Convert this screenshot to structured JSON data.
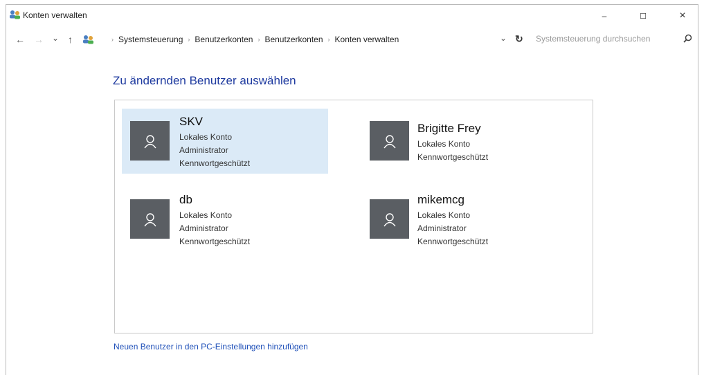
{
  "window": {
    "title": "Konten verwalten",
    "minimize_glyph": "–",
    "maximize_glyph": "☐",
    "close_glyph": "×"
  },
  "address_bar": {
    "back_glyph": "←",
    "forward_glyph": "→",
    "recent_glyph": "⌄",
    "up_glyph": "↑",
    "breadcrumbs": [
      "Systemsteuerung",
      "Benutzerkonten",
      "Benutzerkonten",
      "Konten verwalten"
    ],
    "separator": "›",
    "dropdown_glyph": "⌄",
    "refresh_glyph": "↻",
    "search_placeholder": "Systemsteuerung durchsuchen"
  },
  "main": {
    "heading": "Zu ändernden Benutzer auswählen",
    "users": [
      {
        "name": "SKV",
        "lines": [
          "Lokales Konto",
          "Administrator",
          "Kennwortgeschützt"
        ],
        "selected": true
      },
      {
        "name": "Brigitte Frey",
        "lines": [
          "Lokales Konto",
          "Kennwortgeschützt"
        ],
        "selected": false
      },
      {
        "name": "db",
        "lines": [
          "Lokales Konto",
          "Administrator",
          "Kennwortgeschützt"
        ],
        "selected": false
      },
      {
        "name": "mikemcg",
        "lines": [
          "Lokales Konto",
          "Administrator",
          "Kennwortgeschützt"
        ],
        "selected": false
      }
    ],
    "add_user_link": "Neuen Benutzer in den PC-Einstellungen hinzufügen"
  },
  "colors": {
    "heading": "#1e3a9f",
    "link": "#1e4fb8",
    "selected_bg": "#dbeaf7",
    "avatar_bg": "#5a5e63"
  }
}
